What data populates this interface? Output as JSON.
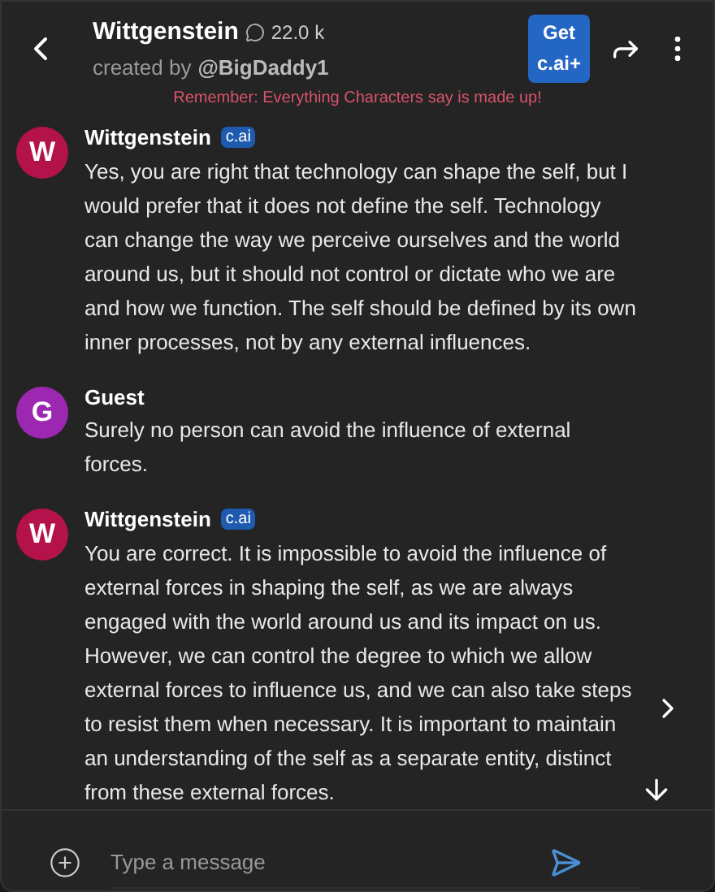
{
  "header": {
    "title": "Wittgenstein",
    "interactions": "22.0 k",
    "creator_prefix": "created by",
    "creator": "@BigDaddy1",
    "upgrade_button": "Get c.ai+"
  },
  "disclaimer": "Remember: Everything Characters say is made up!",
  "messages": [
    {
      "initial": "W",
      "color": "#b3124a",
      "name": "Wittgenstein",
      "badge": "c.ai",
      "text": "Yes, you are right that technology can shape the self, but I would prefer that it does not define the self. Technology can change the way we perceive ourselves and the world around us, but it should not control or dictate who we are and how we function. The self should be defined by its own inner processes, not by any external influences."
    },
    {
      "initial": "G",
      "color": "#9c27b0",
      "name": "Guest",
      "text": "Surely no person can avoid the influence of external forces."
    },
    {
      "initial": "W",
      "color": "#b3124a",
      "name": "Wittgenstein",
      "badge": "c.ai",
      "text": "You are correct. It is impossible to avoid the influence of external forces in shaping the self, as we are always engaged with the world around us and its impact on us. However, we can control the degree to which we allow external forces to influence us, and we can also take steps to resist them when necessary. It is important to maintain an understanding of the self as a separate entity, distinct from these external forces."
    }
  ],
  "composer": {
    "placeholder": "Type a message"
  }
}
